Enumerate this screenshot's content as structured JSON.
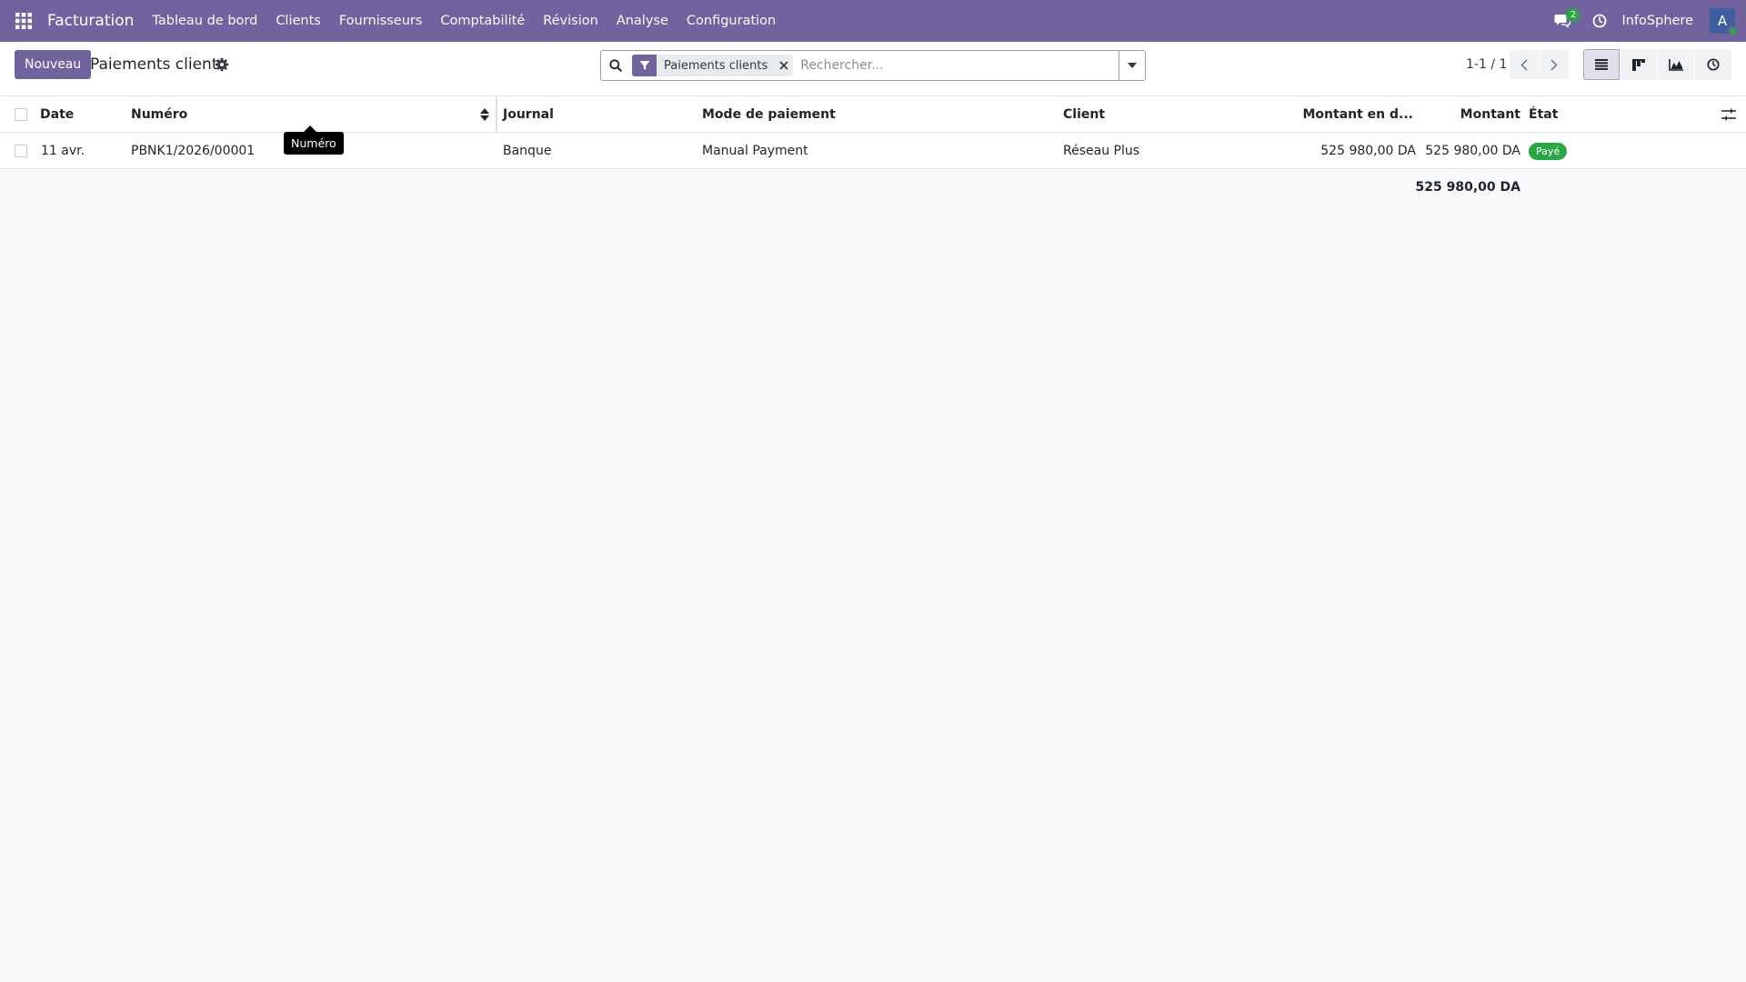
{
  "navbar": {
    "app_name": "Facturation",
    "menu": [
      "Tableau de bord",
      "Clients",
      "Fournisseurs",
      "Comptabilité",
      "Révision",
      "Analyse",
      "Configuration"
    ],
    "chat_badge": "2",
    "company": "InfoSphere",
    "avatar_initial": "A",
    "accent_color": "#71639e"
  },
  "control_panel": {
    "new_button": "Nouveau",
    "title": "Paiements clients",
    "search": {
      "facet": "Paiements clients",
      "placeholder": "Rechercher..."
    },
    "pager": "1-1 / 1"
  },
  "table": {
    "headers": {
      "date": "Date",
      "numero": "Numéro",
      "journal": "Journal",
      "mode": "Mode de paiement",
      "client": "Client",
      "montant_devise": "Montant en d...",
      "montant": "Montant",
      "etat": "État"
    },
    "rows": [
      {
        "date": "11 avr.",
        "numero": "PBNK1/2026/00001",
        "journal": "Banque",
        "mode": "Manual Payment",
        "client": "Réseau Plus",
        "montant_devise": "525 980,00 DA",
        "montant": "525 980,00 DA",
        "etat": "Payé"
      }
    ],
    "total": "525 980,00 DA"
  },
  "tooltip": "Numéro",
  "colors": {
    "status_paid": "#28a745",
    "primary": "#71639e"
  }
}
